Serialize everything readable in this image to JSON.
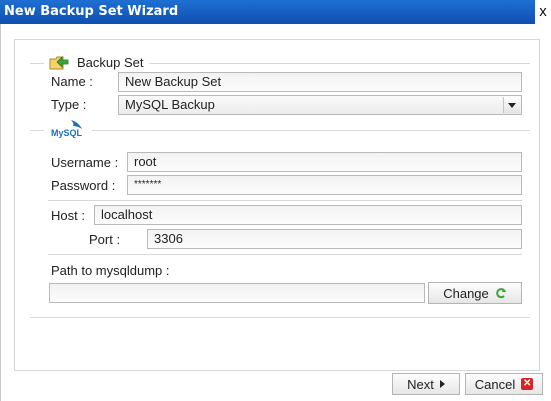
{
  "window": {
    "title": "New Backup Set Wizard",
    "close_glyph": "x"
  },
  "backup_set": {
    "legend": "Backup Set",
    "name_label": "Name :",
    "name_value": "New Backup Set",
    "type_label": "Type :",
    "type_value": "MySQL Backup"
  },
  "mysql": {
    "logo_text": "MySQL",
    "username_label": "Username :",
    "username_value": "root",
    "password_label": "Password :",
    "password_value": "*******",
    "host_label": "Host :",
    "host_value": "localhost",
    "port_label": "Port :",
    "port_value": "3306",
    "path_label": "Path to mysqldump :",
    "path_value": "",
    "change_label": "Change"
  },
  "footer": {
    "next_label": "Next",
    "cancel_label": "Cancel",
    "cancel_glyph": "✕"
  },
  "colors": {
    "titlebar": "#1565c8",
    "accent_green": "#3fa33a",
    "cancel_red": "#d22222",
    "mysql_blue": "#1d70b8"
  }
}
